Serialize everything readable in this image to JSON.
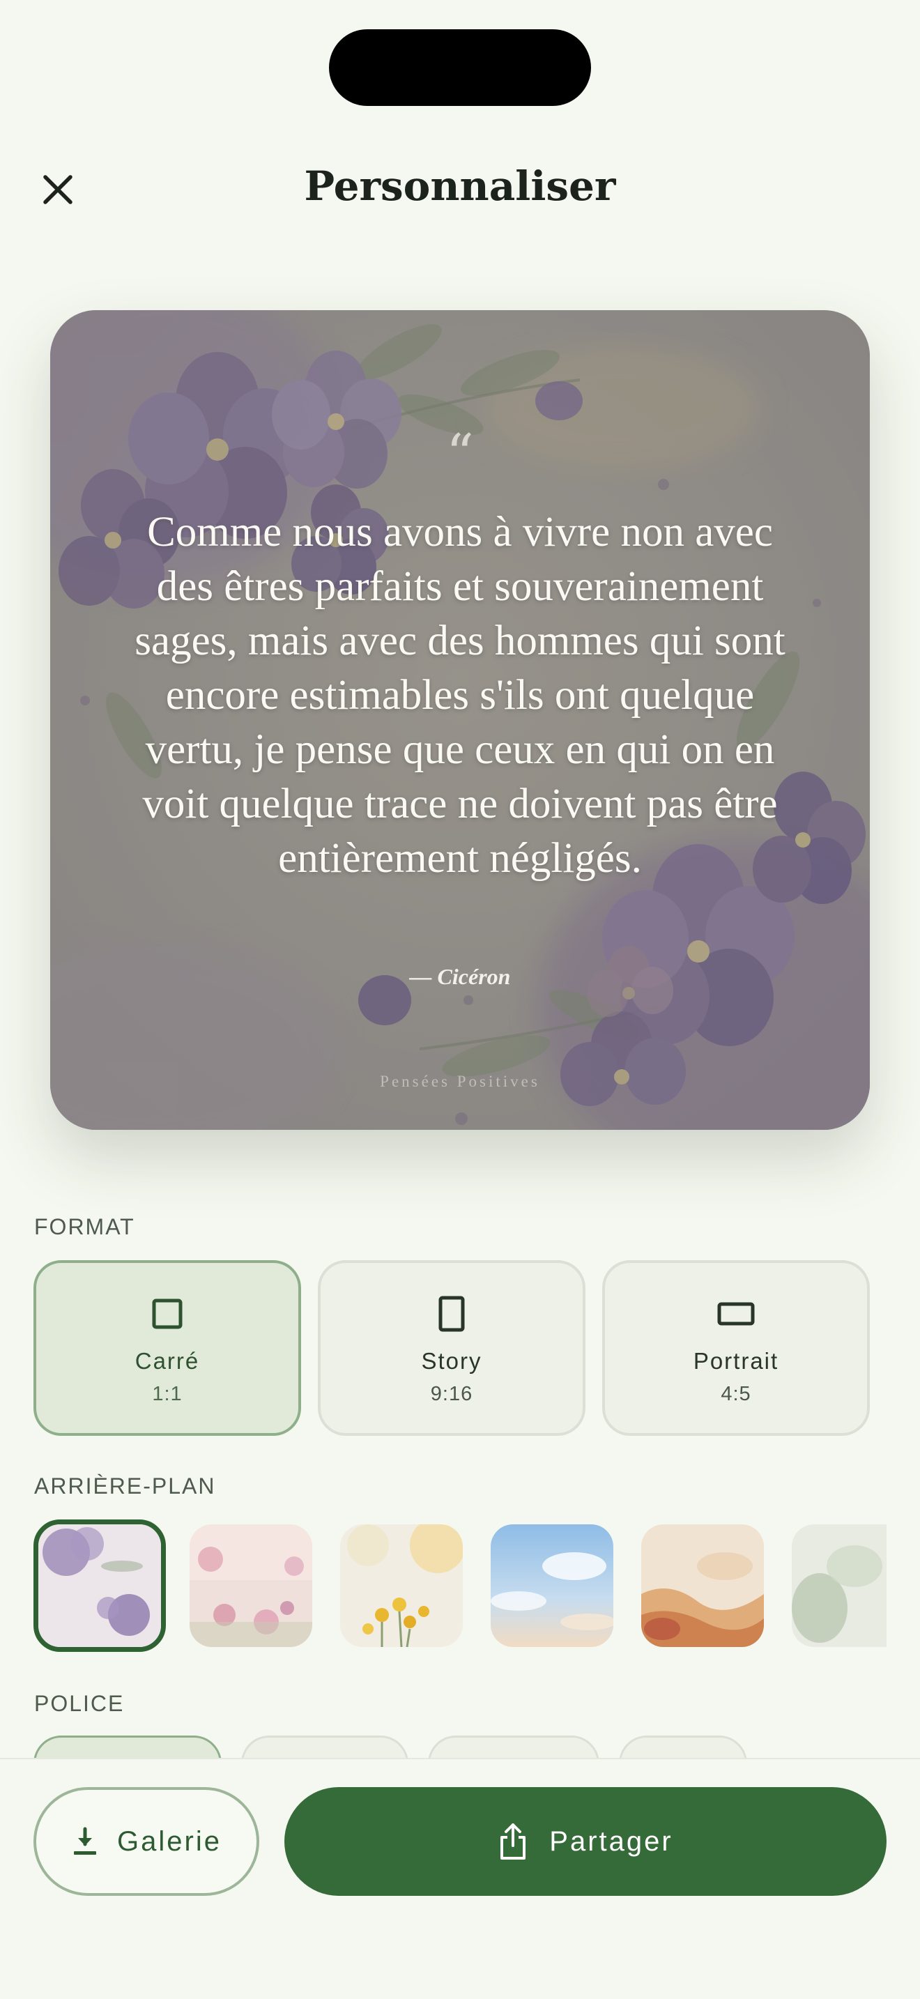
{
  "header": {
    "title": "Personnaliser",
    "close_icon": "close-icon"
  },
  "preview": {
    "quote_mark": "“",
    "quote": "Comme nous avons à vivre non avec des êtres parfaits et souverainement sages, mais avec des hommes qui sont encore estimables s'ils ont quelque vertu, je pense que ceux en qui on en voit quelque trace ne doivent pas être entièrement négligés.",
    "author": "— Cicéron",
    "watermark": "Pensées Positives"
  },
  "format": {
    "label": "FORMAT",
    "options": [
      {
        "name": "Carré",
        "ratio": "1:1",
        "icon": "square-icon",
        "selected": true
      },
      {
        "name": "Story",
        "ratio": "9:16",
        "icon": "portrait-rect-icon",
        "selected": false
      },
      {
        "name": "Portrait",
        "ratio": "4:5",
        "icon": "landscape-rect-icon",
        "selected": false
      }
    ]
  },
  "background": {
    "label": "ARRIÈRE-PLAN",
    "options": [
      {
        "name": "purple-flowers",
        "selected": true
      },
      {
        "name": "pink-flowers",
        "selected": false
      },
      {
        "name": "yellow-flowers",
        "selected": false
      },
      {
        "name": "blue-sky",
        "selected": false
      },
      {
        "name": "amber-watercolor",
        "selected": false
      },
      {
        "name": "green-watercolor",
        "selected": false
      }
    ]
  },
  "font": {
    "label": "POLICE"
  },
  "actions": {
    "gallery_label": "Galerie",
    "gallery_icon": "download-icon",
    "share_label": "Partager",
    "share_icon": "share-icon"
  },
  "colors": {
    "accent": "#356a39",
    "background": "#f5f8f0",
    "selected_fill": "#e1ead9"
  }
}
